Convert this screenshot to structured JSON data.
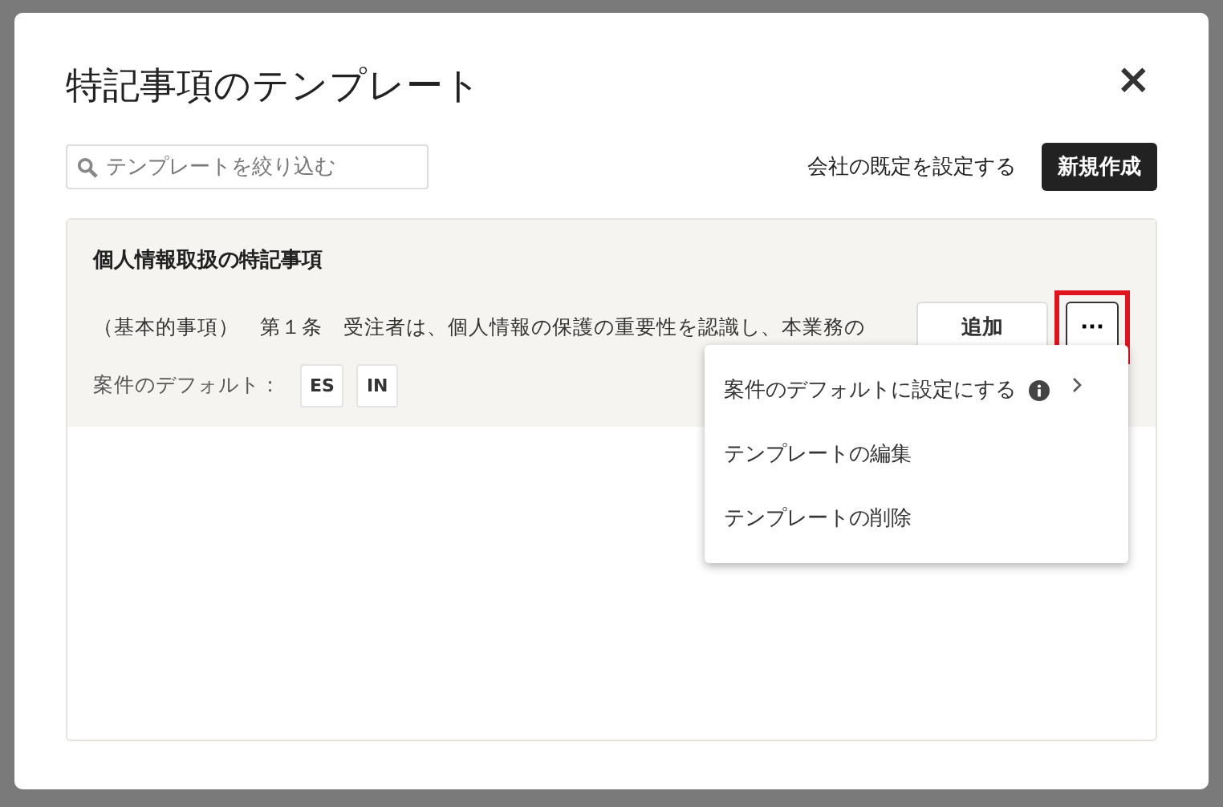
{
  "dialog": {
    "title": "特記事項のテンプレート",
    "close": "×"
  },
  "toolbar": {
    "search": {
      "placeholder": "テンプレートを絞り込む"
    },
    "link": "会社の既定を設定する",
    "button": "新規作成"
  },
  "templates": [
    {
      "title": "個人情報取扱の特記事項",
      "body": "（基本的事項）　第１条　受注者は、個人情報の保護の重要性を認識し、本業務の",
      "add_button": "追加",
      "more_button": "···",
      "more_highlighted": true,
      "defaults_label": "案件のデフォルト：",
      "defaults": [
        "ES",
        "IN"
      ]
    }
  ],
  "menu": {
    "items": [
      {
        "label": "案件のデフォルトに設定にする",
        "kind": "submenu"
      },
      {
        "label": "テンプレートの編集",
        "kind": "action"
      },
      {
        "label": "テンプレートの削除",
        "kind": "action"
      }
    ]
  }
}
